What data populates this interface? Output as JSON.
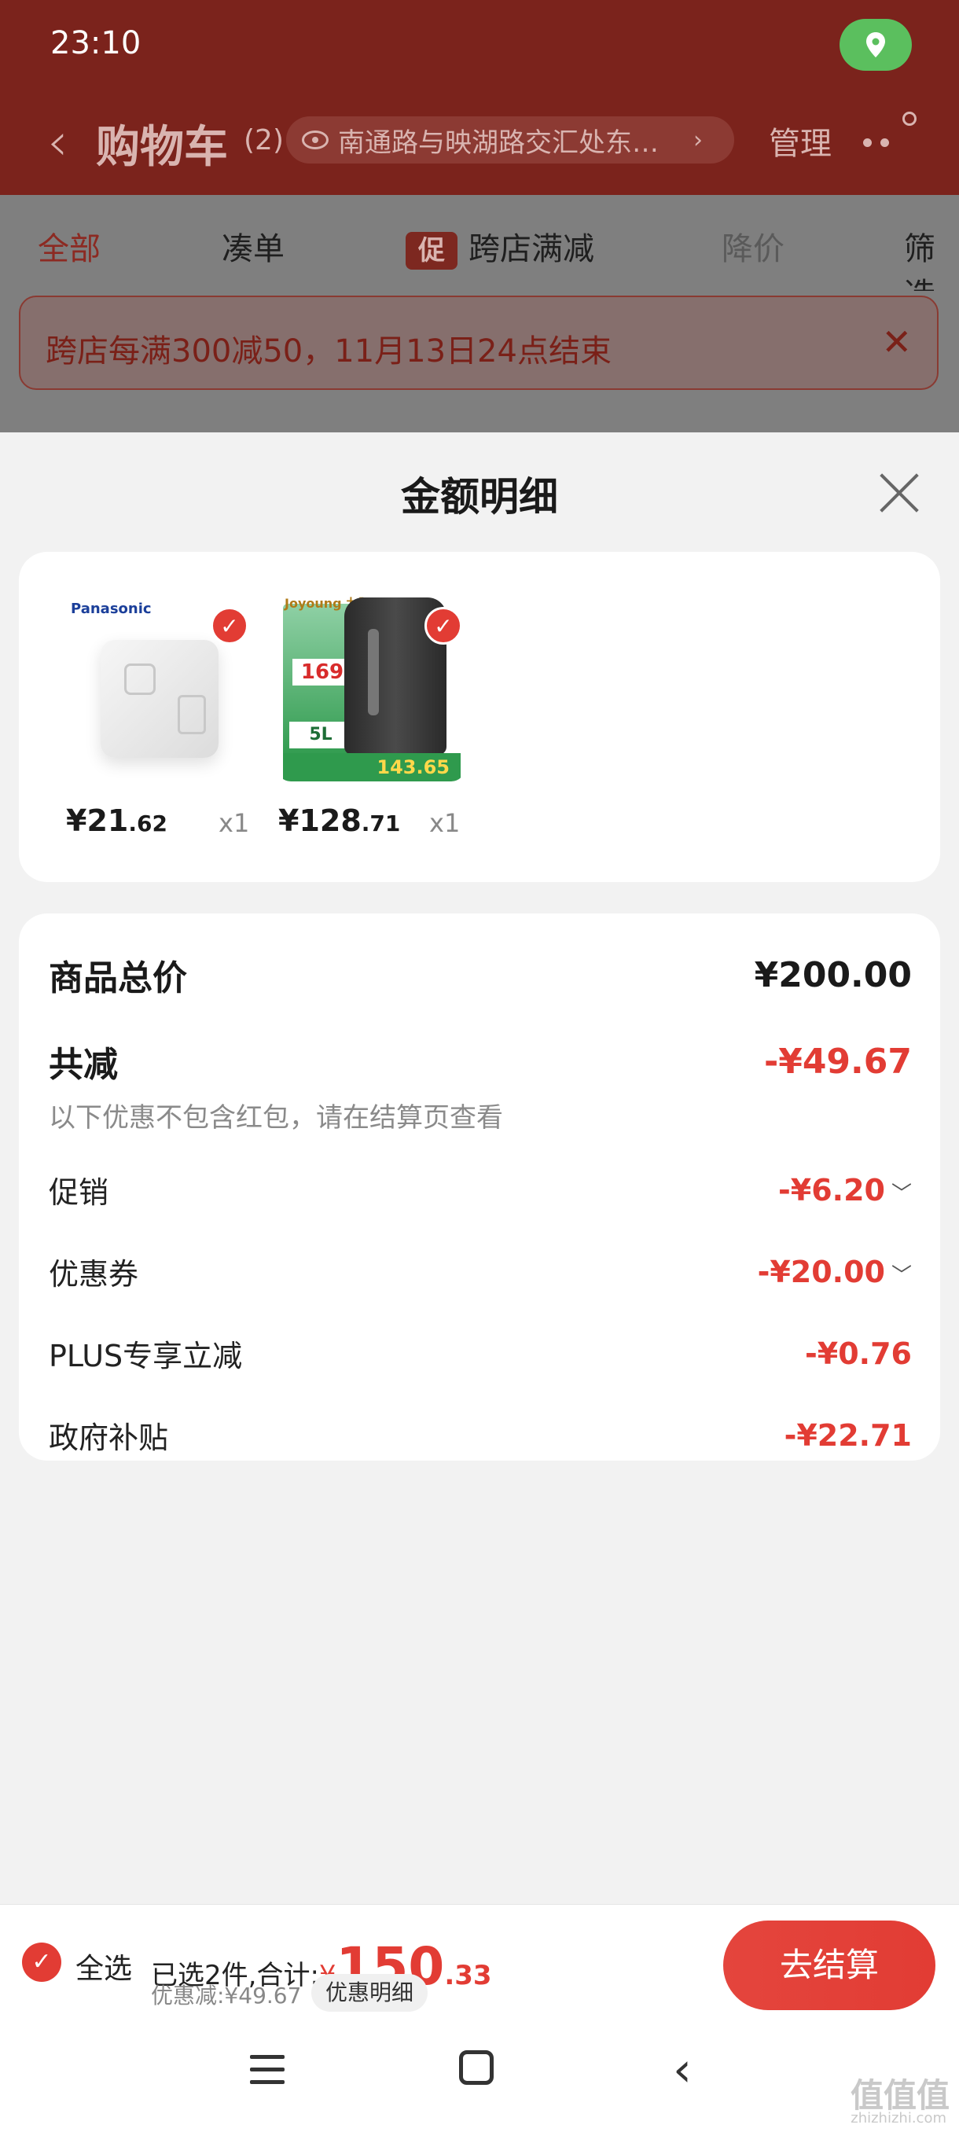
{
  "status": {
    "time": "23:10"
  },
  "header": {
    "title": "购物车",
    "count": "(2)",
    "address": "南通路与映湖路交汇处东…",
    "manage": "管理"
  },
  "filters": {
    "all": "全部",
    "bundle": "凑单",
    "promo_icon": "促",
    "cross_store": "跨店满减",
    "price_drop": "降价",
    "filter": "筛选"
  },
  "banner": {
    "text": "跨店每满300减50，11月13日24点结束",
    "close": "✕"
  },
  "sheet": {
    "title": "金额明细",
    "products": [
      {
        "brand": "Panasonic",
        "price_int": "¥21",
        "price_dec": ".62",
        "qty": "x1"
      },
      {
        "brand": "Joyoung 九阳",
        "badge_price": "169",
        "capacity": "5L",
        "promo_price": "143.65",
        "price_int": "¥128",
        "price_dec": ".71",
        "qty": "x1"
      }
    ],
    "summary": {
      "total_label": "商品总价",
      "total_value": "¥200.00",
      "discount_label": "共减",
      "discount_value": "-¥49.67",
      "note": "以下优惠不包含红包，请在结算页查看",
      "items": [
        {
          "label": "促销",
          "value": "-¥6.20",
          "expandable": true
        },
        {
          "label": "优惠券",
          "value": "-¥20.00",
          "expandable": true
        },
        {
          "label": "PLUS专享立减",
          "value": "-¥0.76",
          "expandable": false
        },
        {
          "label": "政府补贴",
          "value": "-¥22.71",
          "expandable": false
        }
      ]
    }
  },
  "bottom": {
    "select_all": "全选",
    "selected_text": "已选2件,合计:",
    "yen": "¥",
    "total_int": "150",
    "total_dec": ".33",
    "saved": "优惠减:¥49.67",
    "detail_btn": "优惠明细",
    "checkout": "去结算"
  },
  "watermark": {
    "text": "值值值",
    "sub": "zhizhizhi.com"
  },
  "colors": {
    "accent": "#e23c34",
    "header_bg": "#7b231c"
  }
}
